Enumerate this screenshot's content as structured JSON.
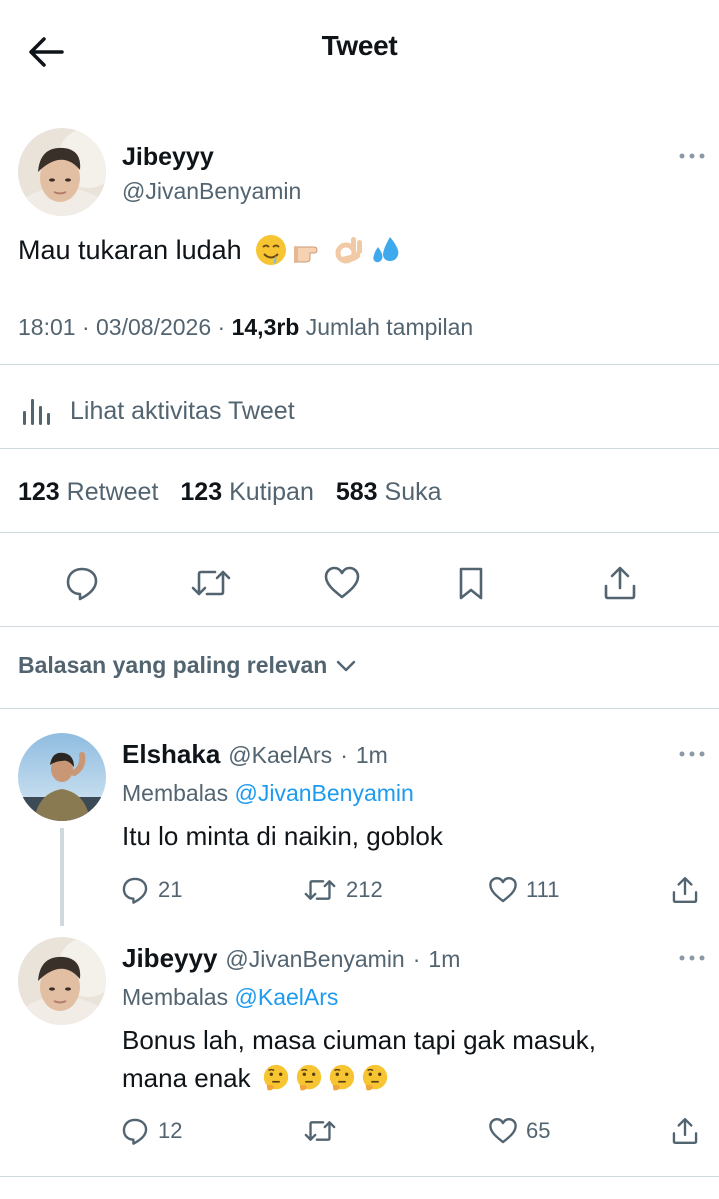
{
  "header": {
    "title": "Tweet",
    "back_icon": "arrow-left-icon"
  },
  "tweet": {
    "author": {
      "name": "Jibeyyy",
      "handle": "@JivanBenyamin"
    },
    "text": "Mau tukaran ludah",
    "emojis": [
      "drooling-face-emoji",
      "pointing-finger-emoji",
      "ok-hand-emoji",
      "sweat-droplets-emoji"
    ],
    "time": "18:01",
    "date": "03/08/2026",
    "views_count": "14,3rb",
    "views_label": "Jumlah tampilan",
    "analytics_label": "Lihat aktivitas Tweet",
    "stats": {
      "retweets_count": "123",
      "retweets_label": "Retweet",
      "quotes_count": "123",
      "quotes_label": "Kutipan",
      "likes_count": "583",
      "likes_label": "Suka"
    },
    "actions": [
      "reply-icon",
      "retweet-icon",
      "like-icon",
      "bookmark-icon",
      "share-icon"
    ]
  },
  "sort_label": "Balasan yang paling relevan",
  "replies": [
    {
      "name": "Elshaka",
      "handle": "@KaelArs",
      "time": "1m",
      "replying_label": "Membalas",
      "replying_to": "@JivanBenyamin",
      "text": "Itu lo minta di naikin, goblok",
      "reply_count": "21",
      "retweet_count": "212",
      "like_count": "111"
    },
    {
      "name": "Jibeyyy",
      "handle": "@JivanBenyamin",
      "time": "1m",
      "replying_label": "Membalas",
      "replying_to": "@KaelArs",
      "text_line1": "Bonus lah, masa ciuman tapi gak masuk,",
      "text_line2": "mana enak",
      "emojis": [
        "thinking-face-emoji",
        "thinking-face-emoji",
        "thinking-face-emoji",
        "thinking-face-emoji"
      ],
      "reply_count": "12",
      "retweet_count": "",
      "like_count": "65"
    }
  ],
  "colors": {
    "text": "#0f1419",
    "secondary": "#536471",
    "link": "#1d9bf0",
    "divider": "#cfd9de"
  }
}
